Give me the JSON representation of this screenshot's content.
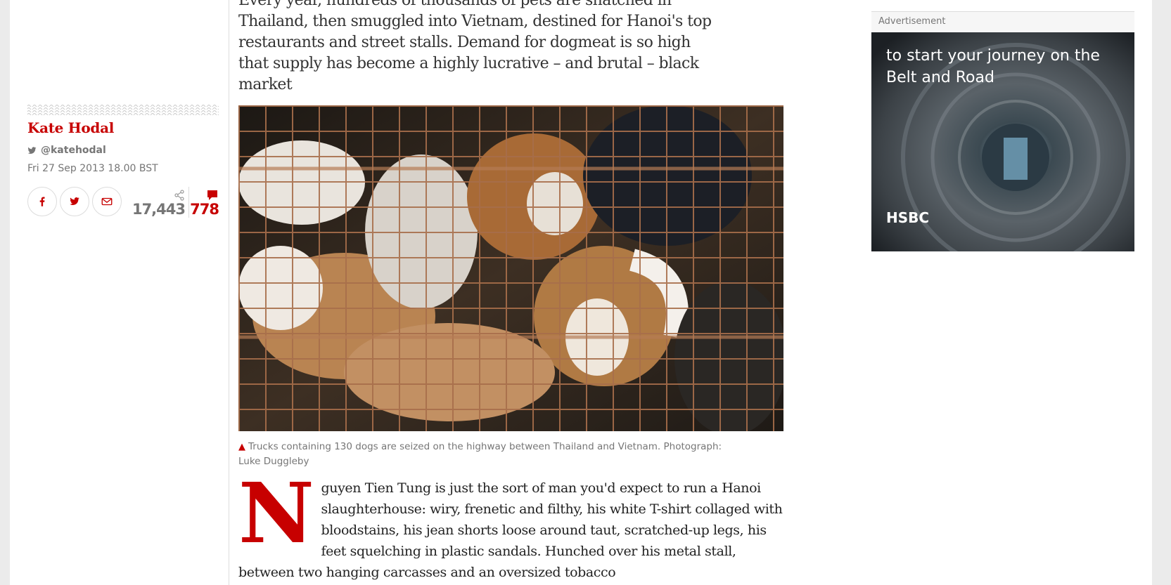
{
  "article": {
    "standfirst": "Every year, hundreds of thousands of pets are snatched in Thailand, then smuggled into Vietnam, destined for Hanoi's top restaurants and street stalls. Demand for dogmeat is so high that supply has become a highly lucrative – and brutal – black market",
    "caption": "Trucks containing 130 dogs are seized on the highway between Thailand and Vietnam. Photograph: Luke Duggleby",
    "dropcap": "N",
    "body": "guyen Tien Tung is just the sort of man you'd expect to run a Hanoi slaughterhouse: wiry, frenetic and filthy, his white T-shirt collaged with bloodstains, his jean shorts loose around taut, scratched-up legs, his feet squelching in plastic sandals. Hunched over his metal stall, between two hanging carcasses and an oversized tobacco"
  },
  "meta": {
    "author": "Kate Hodal",
    "twitter": "@katehodal",
    "date": "Fri 27 Sep 2013 18.00 BST",
    "share_count": "17,443",
    "comment_count": "778",
    "icons": [
      "facebook-icon",
      "twitter-icon",
      "email-icon",
      "share-icon",
      "comment-icon"
    ]
  },
  "advertisement": {
    "label": "Advertisement",
    "headline": "to start your journey on the Belt and Road",
    "brand": "HSBC",
    "brand_color": "#db0011"
  },
  "colors": {
    "accent": "#c70000",
    "meta_text": "#767676"
  }
}
